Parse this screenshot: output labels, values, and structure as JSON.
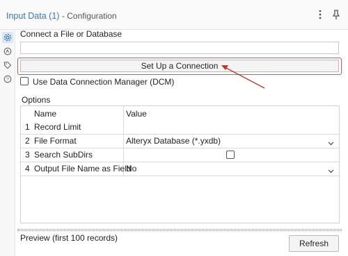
{
  "header": {
    "title": "Input Data (1)",
    "subtitle": "- Configuration"
  },
  "leftbar": {
    "icons": [
      "gear-icon",
      "annotation-icon",
      "tag-icon",
      "help-icon"
    ]
  },
  "connection": {
    "label": "Connect a File or Database",
    "input_value": "",
    "setup_button": "Set Up a Connection",
    "dcm_label": "Use Data Connection Manager (DCM)",
    "dcm_checked": false
  },
  "options": {
    "label": "Options",
    "headers": {
      "name": "Name",
      "value": "Value"
    },
    "rows": [
      {
        "num": "1",
        "name": "Record Limit",
        "value": ""
      },
      {
        "num": "2",
        "name": "File Format",
        "value": "Alteryx Database (*.yxdb)"
      },
      {
        "num": "3",
        "name": "Search SubDirs",
        "value": ""
      },
      {
        "num": "4",
        "name": "Output File Name as Field",
        "value": "No"
      }
    ]
  },
  "preview": {
    "label": "Preview (first 100 records)",
    "refresh_button": "Refresh"
  },
  "colors": {
    "title_blue": "#3a78b5",
    "highlight_red": "#d9534f"
  }
}
